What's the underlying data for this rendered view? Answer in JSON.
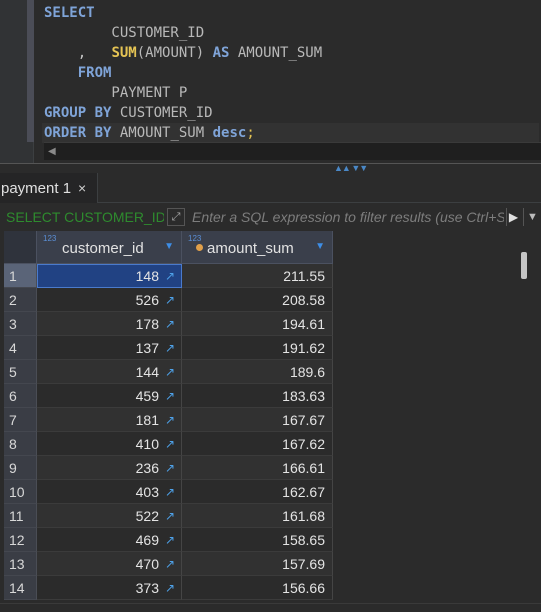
{
  "editor": {
    "lines": [
      {
        "parts": [
          {
            "t": "SELECT",
            "c": "kw"
          }
        ]
      },
      {
        "parts": [
          {
            "t": "        CUSTOMER_ID",
            "c": "id"
          }
        ]
      },
      {
        "parts": [
          {
            "t": "    ,   ",
            "c": "pn"
          },
          {
            "t": "SUM",
            "c": "fn"
          },
          {
            "t": "(AMOUNT) ",
            "c": "id"
          },
          {
            "t": "AS",
            "c": "kw"
          },
          {
            "t": " AMOUNT_SUM",
            "c": "id"
          }
        ]
      },
      {
        "parts": [
          {
            "t": "    ",
            "c": "pn"
          },
          {
            "t": "FROM",
            "c": "kw"
          }
        ]
      },
      {
        "parts": [
          {
            "t": "        PAYMENT P",
            "c": "id"
          }
        ]
      },
      {
        "parts": [
          {
            "t": "GROUP BY",
            "c": "kw"
          },
          {
            "t": " CUSTOMER_ID",
            "c": "id"
          }
        ]
      },
      {
        "parts": [
          {
            "t": "ORDER BY",
            "c": "kw"
          },
          {
            "t": " AMOUNT_SUM ",
            "c": "id"
          },
          {
            "t": "desc",
            "c": "kw"
          },
          {
            "t": ";",
            "c": "sc"
          }
        ],
        "highlight": true
      }
    ]
  },
  "results_tab": {
    "label": "payment 1",
    "close": "×"
  },
  "filter": {
    "sql_preview": "SELECT CUSTOMER_ID",
    "placeholder": "Enter a SQL expression to filter results (use Ctrl+Space)"
  },
  "grid": {
    "columns": [
      {
        "name": "customer_id",
        "type_badge": "123"
      },
      {
        "name": "amount_sum",
        "type_badge": "123"
      }
    ],
    "rows": [
      {
        "n": "1",
        "customer_id": "148",
        "amount_sum": "211.55"
      },
      {
        "n": "2",
        "customer_id": "526",
        "amount_sum": "208.58"
      },
      {
        "n": "3",
        "customer_id": "178",
        "amount_sum": "194.61"
      },
      {
        "n": "4",
        "customer_id": "137",
        "amount_sum": "191.62"
      },
      {
        "n": "5",
        "customer_id": "144",
        "amount_sum": "189.6"
      },
      {
        "n": "6",
        "customer_id": "459",
        "amount_sum": "183.63"
      },
      {
        "n": "7",
        "customer_id": "181",
        "amount_sum": "167.67"
      },
      {
        "n": "8",
        "customer_id": "410",
        "amount_sum": "167.62"
      },
      {
        "n": "9",
        "customer_id": "236",
        "amount_sum": "166.61"
      },
      {
        "n": "10",
        "customer_id": "403",
        "amount_sum": "162.67"
      },
      {
        "n": "11",
        "customer_id": "522",
        "amount_sum": "161.68"
      },
      {
        "n": "12",
        "customer_id": "469",
        "amount_sum": "158.65"
      },
      {
        "n": "13",
        "customer_id": "470",
        "amount_sum": "157.69"
      },
      {
        "n": "14",
        "customer_id": "373",
        "amount_sum": "156.66"
      }
    ],
    "selected_row": 0
  },
  "colors": {
    "keyword": "#7fa4d8",
    "function": "#e5c454",
    "selection": "#214283",
    "link_icon": "#4ea1e8"
  }
}
